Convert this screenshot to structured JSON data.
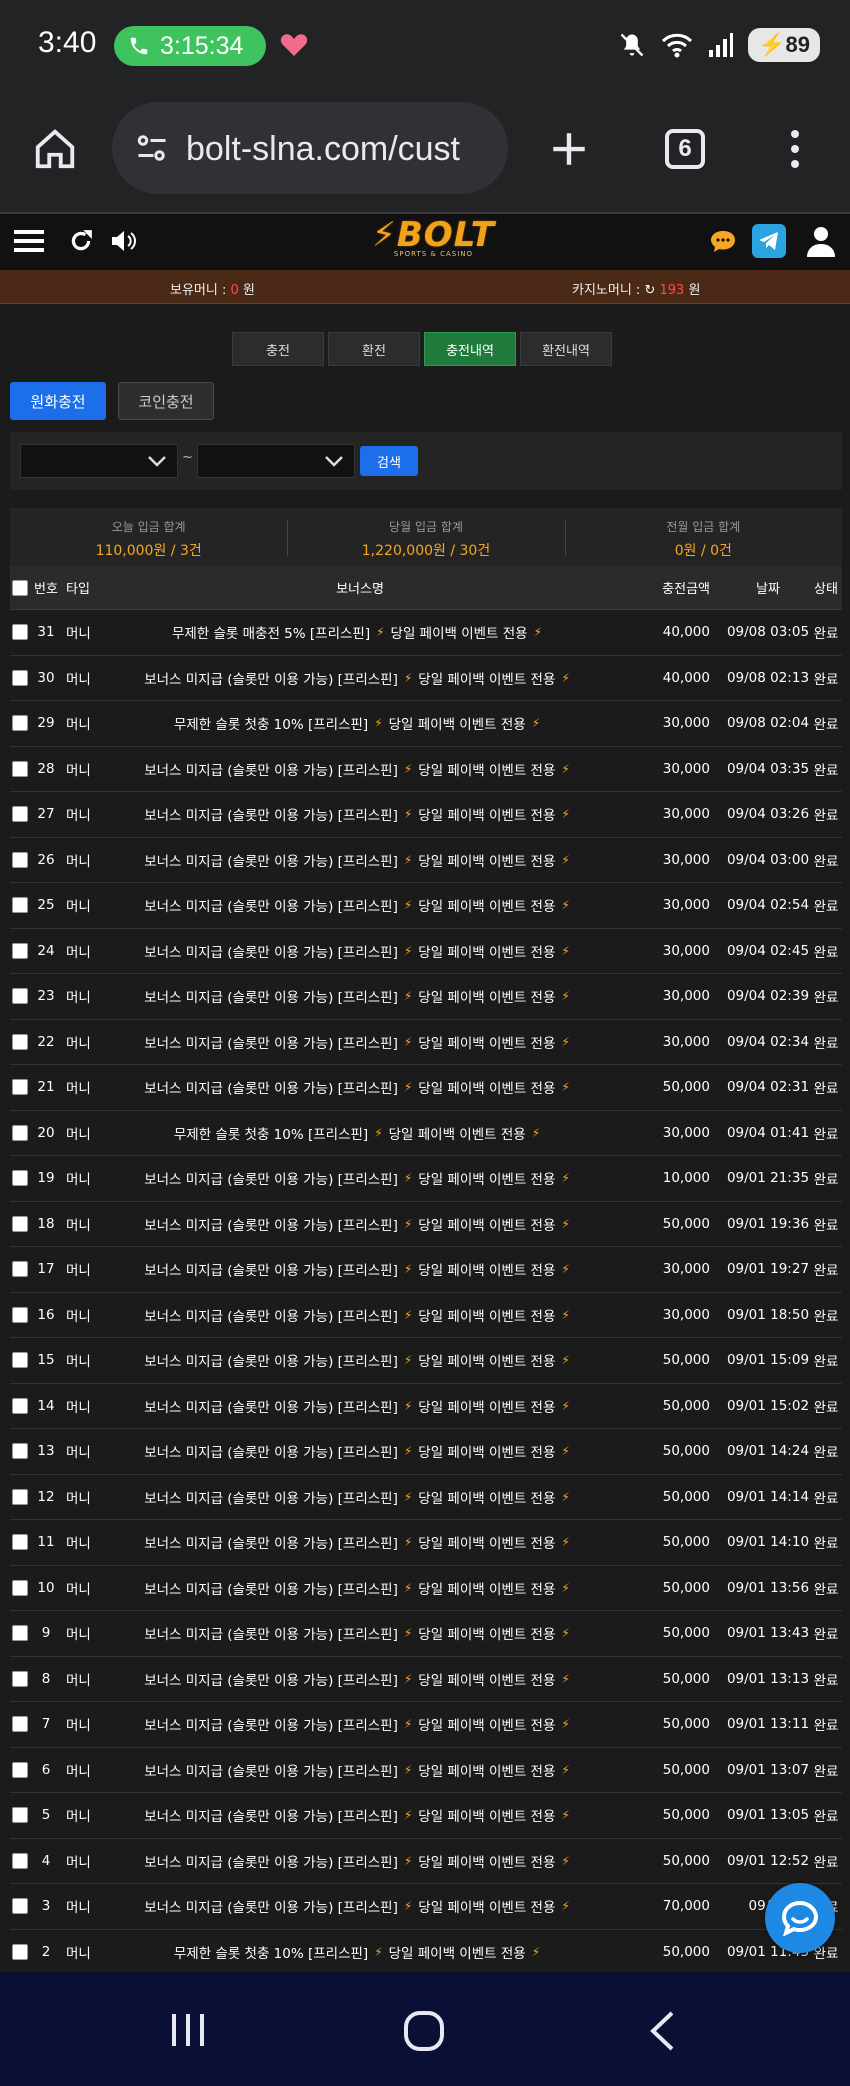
{
  "status_bar": {
    "time": "3:40",
    "call_timer": "3:15:34",
    "battery": "89"
  },
  "browser": {
    "url": "bolt-slna.com/cust",
    "tab_count": "6"
  },
  "site": {
    "logo_main": "BOLT",
    "logo_sub": "SPORTS & CASINO",
    "money_label": "보유머니 : ",
    "money_value": "0",
    "money_unit": " 원",
    "casino_label": "카지노머니 : ",
    "casino_value": "193",
    "casino_unit": " 원"
  },
  "tabs": [
    "충전",
    "환전",
    "충전내역",
    "환전내역"
  ],
  "subtabs": {
    "krw": "원화충전",
    "coin": "코인충전"
  },
  "filter": {
    "tilde": "~",
    "search": "검색"
  },
  "summary": [
    {
      "label": "오늘 입금 합계",
      "value": "110,000원 / 3건"
    },
    {
      "label": "당월 입금 합계",
      "value": "1,220,000원 / 30건"
    },
    {
      "label": "전월 입금 합계",
      "value": "0원 / 0건"
    }
  ],
  "table": {
    "headers": {
      "no": "번호",
      "type": "타입",
      "name": "보너스명",
      "amount": "충전금액",
      "date": "날짜",
      "status": "상태"
    },
    "rows": [
      {
        "no": "31",
        "type": "머니",
        "name_a": "무제한 슬롯 매충전 5% [프리스핀]",
        "name_b": "당일 페이백 이벤트 전용",
        "amount": "40,000",
        "date": "09/08 03:05",
        "status": "완료"
      },
      {
        "no": "30",
        "type": "머니",
        "name_a": "보너스 미지급 (슬롯만 이용 가능) [프리스핀]",
        "name_b": "당일 페이백 이벤트 전용",
        "amount": "40,000",
        "date": "09/08 02:13",
        "status": "완료"
      },
      {
        "no": "29",
        "type": "머니",
        "name_a": "무제한 슬롯 첫충 10% [프리스핀]",
        "name_b": "당일 페이백 이벤트 전용",
        "amount": "30,000",
        "date": "09/08 02:04",
        "status": "완료"
      },
      {
        "no": "28",
        "type": "머니",
        "name_a": "보너스 미지급 (슬롯만 이용 가능) [프리스핀]",
        "name_b": "당일 페이백 이벤트 전용",
        "amount": "30,000",
        "date": "09/04 03:35",
        "status": "완료"
      },
      {
        "no": "27",
        "type": "머니",
        "name_a": "보너스 미지급 (슬롯만 이용 가능) [프리스핀]",
        "name_b": "당일 페이백 이벤트 전용",
        "amount": "30,000",
        "date": "09/04 03:26",
        "status": "완료"
      },
      {
        "no": "26",
        "type": "머니",
        "name_a": "보너스 미지급 (슬롯만 이용 가능) [프리스핀]",
        "name_b": "당일 페이백 이벤트 전용",
        "amount": "30,000",
        "date": "09/04 03:00",
        "status": "완료"
      },
      {
        "no": "25",
        "type": "머니",
        "name_a": "보너스 미지급 (슬롯만 이용 가능) [프리스핀]",
        "name_b": "당일 페이백 이벤트 전용",
        "amount": "30,000",
        "date": "09/04 02:54",
        "status": "완료"
      },
      {
        "no": "24",
        "type": "머니",
        "name_a": "보너스 미지급 (슬롯만 이용 가능) [프리스핀]",
        "name_b": "당일 페이백 이벤트 전용",
        "amount": "30,000",
        "date": "09/04 02:45",
        "status": "완료"
      },
      {
        "no": "23",
        "type": "머니",
        "name_a": "보너스 미지급 (슬롯만 이용 가능) [프리스핀]",
        "name_b": "당일 페이백 이벤트 전용",
        "amount": "30,000",
        "date": "09/04 02:39",
        "status": "완료"
      },
      {
        "no": "22",
        "type": "머니",
        "name_a": "보너스 미지급 (슬롯만 이용 가능) [프리스핀]",
        "name_b": "당일 페이백 이벤트 전용",
        "amount": "30,000",
        "date": "09/04 02:34",
        "status": "완료"
      },
      {
        "no": "21",
        "type": "머니",
        "name_a": "보너스 미지급 (슬롯만 이용 가능) [프리스핀]",
        "name_b": "당일 페이백 이벤트 전용",
        "amount": "50,000",
        "date": "09/04 02:31",
        "status": "완료"
      },
      {
        "no": "20",
        "type": "머니",
        "name_a": "무제한 슬롯 첫충 10% [프리스핀]",
        "name_b": "당일 페이백 이벤트 전용",
        "amount": "30,000",
        "date": "09/04 01:41",
        "status": "완료"
      },
      {
        "no": "19",
        "type": "머니",
        "name_a": "보너스 미지급 (슬롯만 이용 가능) [프리스핀]",
        "name_b": "당일 페이백 이벤트 전용",
        "amount": "10,000",
        "date": "09/01 21:35",
        "status": "완료"
      },
      {
        "no": "18",
        "type": "머니",
        "name_a": "보너스 미지급 (슬롯만 이용 가능) [프리스핀]",
        "name_b": "당일 페이백 이벤트 전용",
        "amount": "50,000",
        "date": "09/01 19:36",
        "status": "완료"
      },
      {
        "no": "17",
        "type": "머니",
        "name_a": "보너스 미지급 (슬롯만 이용 가능) [프리스핀]",
        "name_b": "당일 페이백 이벤트 전용",
        "amount": "30,000",
        "date": "09/01 19:27",
        "status": "완료"
      },
      {
        "no": "16",
        "type": "머니",
        "name_a": "보너스 미지급 (슬롯만 이용 가능) [프리스핀]",
        "name_b": "당일 페이백 이벤트 전용",
        "amount": "30,000",
        "date": "09/01 18:50",
        "status": "완료"
      },
      {
        "no": "15",
        "type": "머니",
        "name_a": "보너스 미지급 (슬롯만 이용 가능) [프리스핀]",
        "name_b": "당일 페이백 이벤트 전용",
        "amount": "50,000",
        "date": "09/01 15:09",
        "status": "완료"
      },
      {
        "no": "14",
        "type": "머니",
        "name_a": "보너스 미지급 (슬롯만 이용 가능) [프리스핀]",
        "name_b": "당일 페이백 이벤트 전용",
        "amount": "50,000",
        "date": "09/01 15:02",
        "status": "완료"
      },
      {
        "no": "13",
        "type": "머니",
        "name_a": "보너스 미지급 (슬롯만 이용 가능) [프리스핀]",
        "name_b": "당일 페이백 이벤트 전용",
        "amount": "50,000",
        "date": "09/01 14:24",
        "status": "완료"
      },
      {
        "no": "12",
        "type": "머니",
        "name_a": "보너스 미지급 (슬롯만 이용 가능) [프리스핀]",
        "name_b": "당일 페이백 이벤트 전용",
        "amount": "50,000",
        "date": "09/01 14:14",
        "status": "완료"
      },
      {
        "no": "11",
        "type": "머니",
        "name_a": "보너스 미지급 (슬롯만 이용 가능) [프리스핀]",
        "name_b": "당일 페이백 이벤트 전용",
        "amount": "50,000",
        "date": "09/01 14:10",
        "status": "완료"
      },
      {
        "no": "10",
        "type": "머니",
        "name_a": "보너스 미지급 (슬롯만 이용 가능) [프리스핀]",
        "name_b": "당일 페이백 이벤트 전용",
        "amount": "50,000",
        "date": "09/01 13:56",
        "status": "완료"
      },
      {
        "no": "9",
        "type": "머니",
        "name_a": "보너스 미지급 (슬롯만 이용 가능) [프리스핀]",
        "name_b": "당일 페이백 이벤트 전용",
        "amount": "50,000",
        "date": "09/01 13:43",
        "status": "완료"
      },
      {
        "no": "8",
        "type": "머니",
        "name_a": "보너스 미지급 (슬롯만 이용 가능) [프리스핀]",
        "name_b": "당일 페이백 이벤트 전용",
        "amount": "50,000",
        "date": "09/01 13:13",
        "status": "완료"
      },
      {
        "no": "7",
        "type": "머니",
        "name_a": "보너스 미지급 (슬롯만 이용 가능) [프리스핀]",
        "name_b": "당일 페이백 이벤트 전용",
        "amount": "50,000",
        "date": "09/01 13:11",
        "status": "완료"
      },
      {
        "no": "6",
        "type": "머니",
        "name_a": "보너스 미지급 (슬롯만 이용 가능) [프리스핀]",
        "name_b": "당일 페이백 이벤트 전용",
        "amount": "50,000",
        "date": "09/01 13:07",
        "status": "완료"
      },
      {
        "no": "5",
        "type": "머니",
        "name_a": "보너스 미지급 (슬롯만 이용 가능) [프리스핀]",
        "name_b": "당일 페이백 이벤트 전용",
        "amount": "50,000",
        "date": "09/01 13:05",
        "status": "완료"
      },
      {
        "no": "4",
        "type": "머니",
        "name_a": "보너스 미지급 (슬롯만 이용 가능) [프리스핀]",
        "name_b": "당일 페이백 이벤트 전용",
        "amount": "50,000",
        "date": "09/01 12:52",
        "status": "완료"
      },
      {
        "no": "3",
        "type": "머니",
        "name_a": "보너스 미지급 (슬롯만 이용 가능) [프리스핀]",
        "name_b": "당일 페이백 이벤트 전용",
        "amount": "70,000",
        "date": "09/01",
        "status": "완료"
      },
      {
        "no": "2",
        "type": "머니",
        "name_a": "무제한 슬롯 첫충 10% [프리스핀]",
        "name_b": "당일 페이백 이벤트 전용",
        "amount": "50,000",
        "date": "09/01 11:45",
        "status": "완료"
      }
    ]
  },
  "icons": {
    "menu": "menu-icon",
    "refresh": "refresh-icon",
    "sound": "speaker-icon",
    "chat": "chat-bubble-icon",
    "telegram": "telegram-icon",
    "user": "user-icon",
    "bolt": "lightning-bolt-icon",
    "support": "support-chat-icon"
  },
  "colors": {
    "accent_green": "#1f7a3c",
    "accent_blue": "#1c6fe8",
    "gold": "#f5a623",
    "money_bar": "#4a2a16",
    "red": "#ff4a4a"
  }
}
